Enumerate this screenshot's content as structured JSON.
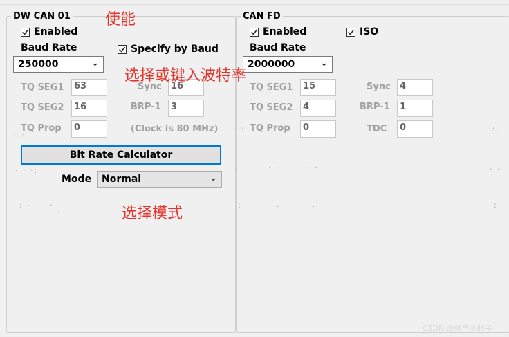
{
  "left": {
    "title": "DW CAN 01",
    "enabled": {
      "label": "Enabled",
      "checked": true
    },
    "baud_rate_label": "Baud Rate",
    "baud_rate_value": "250000",
    "specify_by_baud": {
      "label": "Specify by Baud",
      "checked": true
    },
    "tq_seg1": {
      "label": "TQ SEG1",
      "value": "63"
    },
    "tq_seg2": {
      "label": "TQ SEG2",
      "value": "16"
    },
    "tq_prop": {
      "label": "TQ Prop",
      "value": "0"
    },
    "sync": {
      "label": "Sync",
      "value": "16"
    },
    "brp": {
      "label": "BRP-1",
      "value": "3"
    },
    "clock_note": "(Clock is 80 MHz)",
    "calc_button": "Bit Rate Calculator",
    "mode_label": "Mode",
    "mode_value": "Normal"
  },
  "right": {
    "title": "CAN FD",
    "enabled": {
      "label": "Enabled",
      "checked": true
    },
    "iso": {
      "label": "ISO",
      "checked": true
    },
    "baud_rate_label": "Baud Rate",
    "baud_rate_value": "2000000",
    "tq_seg1": {
      "label": "TQ SEG1",
      "value": "15"
    },
    "tq_seg2": {
      "label": "TQ SEG2",
      "value": "4"
    },
    "tq_prop": {
      "label": "TQ Prop",
      "value": "0"
    },
    "sync": {
      "label": "Sync",
      "value": "4"
    },
    "brp": {
      "label": "BRP-1",
      "value": "1"
    },
    "tdc": {
      "label": "TDC",
      "value": "0"
    }
  },
  "annotations": {
    "enable": "使能",
    "select_baud": "选择或键入波特率",
    "select_mode": "选择模式"
  },
  "watermark": "CSDN @帅气小胖子",
  "colors": {
    "annotation": "#e8332b",
    "focus_border": "#0078d7",
    "disabled_text": "#a0a0a0"
  },
  "icons": {
    "checkbox": "check-icon",
    "dropdown": "chevron-down-icon"
  }
}
